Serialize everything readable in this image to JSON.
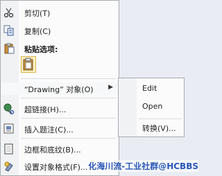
{
  "context_menu": {
    "items": [
      {
        "label": "剪切(T)",
        "icon": "scissors-icon"
      },
      {
        "label": "复制(C)",
        "icon": "copy-icon"
      },
      {
        "label": "粘贴选项:",
        "icon": "paste-clipboard-icon"
      },
      {
        "label": "“Drawing” 对象(O)",
        "icon": ""
      },
      {
        "label": "超链接(H)...",
        "icon": "hyperlink-globe-icon"
      },
      {
        "label": "插入题注(C)...",
        "icon": "caption-icon"
      },
      {
        "label": "边框和底纹(B)...",
        "icon": "borders-icon"
      },
      {
        "label": "设置对象格式(F)...",
        "icon": "format-object-icon"
      }
    ],
    "submenu_arrow": "▶"
  },
  "submenu": {
    "items": [
      {
        "label": "Edit"
      },
      {
        "label": "Open"
      },
      {
        "label": "转换(V)..."
      }
    ]
  },
  "watermark": "化海川流-工业社群@HCBBS"
}
